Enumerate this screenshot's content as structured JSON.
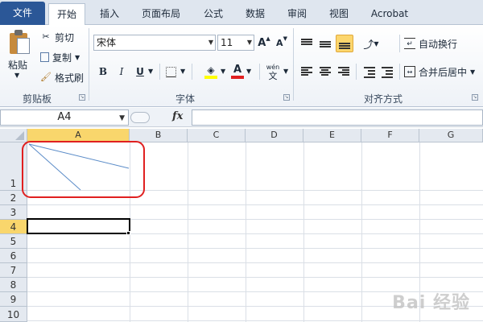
{
  "tabs": [
    {
      "label": "文件"
    },
    {
      "label": "开始"
    },
    {
      "label": "插入"
    },
    {
      "label": "页面布局"
    },
    {
      "label": "公式"
    },
    {
      "label": "数据"
    },
    {
      "label": "审阅"
    },
    {
      "label": "视图"
    },
    {
      "label": "Acrobat"
    }
  ],
  "ribbon": {
    "clipboard": {
      "paste_label": "粘贴",
      "cut_label": "剪切",
      "copy_label": "复制",
      "format_painter_label": "格式刷",
      "group_label": "剪贴板"
    },
    "font": {
      "font_name": "宋体",
      "font_size": "11",
      "grow_label": "A",
      "shrink_label": "A",
      "bold_label": "B",
      "italic_label": "I",
      "underline_label": "U",
      "phonetic_label": "wén",
      "phonetic_char": "文",
      "font_color_label": "A",
      "group_label": "字体"
    },
    "alignment": {
      "wrap_label": "自动换行",
      "merge_label": "合并后居中",
      "group_label": "对齐方式"
    }
  },
  "formula_bar": {
    "name_box": "A4",
    "fx_label": "fx",
    "value": ""
  },
  "grid": {
    "columns": [
      "A",
      "B",
      "C",
      "D",
      "E",
      "F",
      "G"
    ],
    "rows": [
      "1",
      "2",
      "3",
      "4",
      "5",
      "6",
      "7",
      "8",
      "9",
      "10"
    ],
    "selected_column": "A",
    "selected_row": "4"
  },
  "watermark": "Bai 经验",
  "colors": {
    "file_tab": "#2b5797",
    "annotation": "#e02020",
    "header_selected": "#f9d66c",
    "diagonal_line": "#5b8cc8"
  }
}
